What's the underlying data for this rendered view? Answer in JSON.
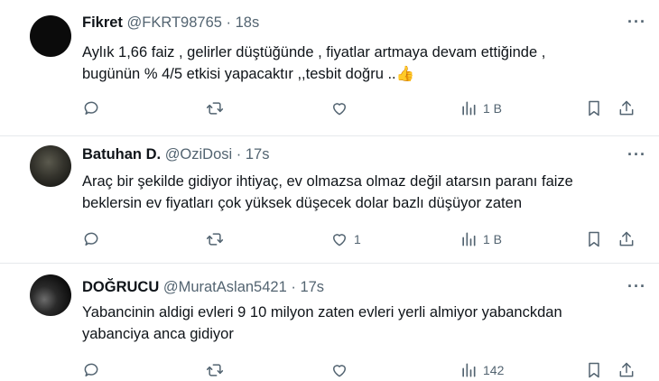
{
  "tweets": [
    {
      "name": "Fikret",
      "handle": "@FKRT98765",
      "time": "· 18s",
      "text1": "Aylık 1,66 faiz , gelirler düştüğünde , fiyatlar artmaya devam ettiğinde ,",
      "text2": "bugünün % 4/5 etkisi yapacaktır ,,tesbit doğru ..👍",
      "likes": "",
      "views": "1 B",
      "avatar": "black"
    },
    {
      "name": "Batuhan D.",
      "handle": "@OziDosi",
      "time": "· 17s",
      "text1": "Araç bir şekilde gidiyor ihtiyaç, ev olmazsa olmaz değil atarsın paranı faize",
      "text2": "beklersin ev fiyatları çok yüksek düşecek dolar bazlı düşüyor zaten",
      "likes": "1",
      "views": "1 B",
      "avatar": "dark-photo"
    },
    {
      "name": "DOĞRUCU",
      "handle": "@MuratAslan5421",
      "time": "· 17s",
      "text1": "Yabancinin aldigi evleri 9 10 milyon zaten evleri yerli almiyor yabanckdan",
      "text2": "yabanciya anca gidiyor",
      "likes": "",
      "views": "142",
      "avatar": "dark-photo"
    }
  ],
  "more_label": "···",
  "colors": {
    "text": "#0f1419",
    "secondary": "#536471",
    "divider": "#e6e9ec"
  }
}
